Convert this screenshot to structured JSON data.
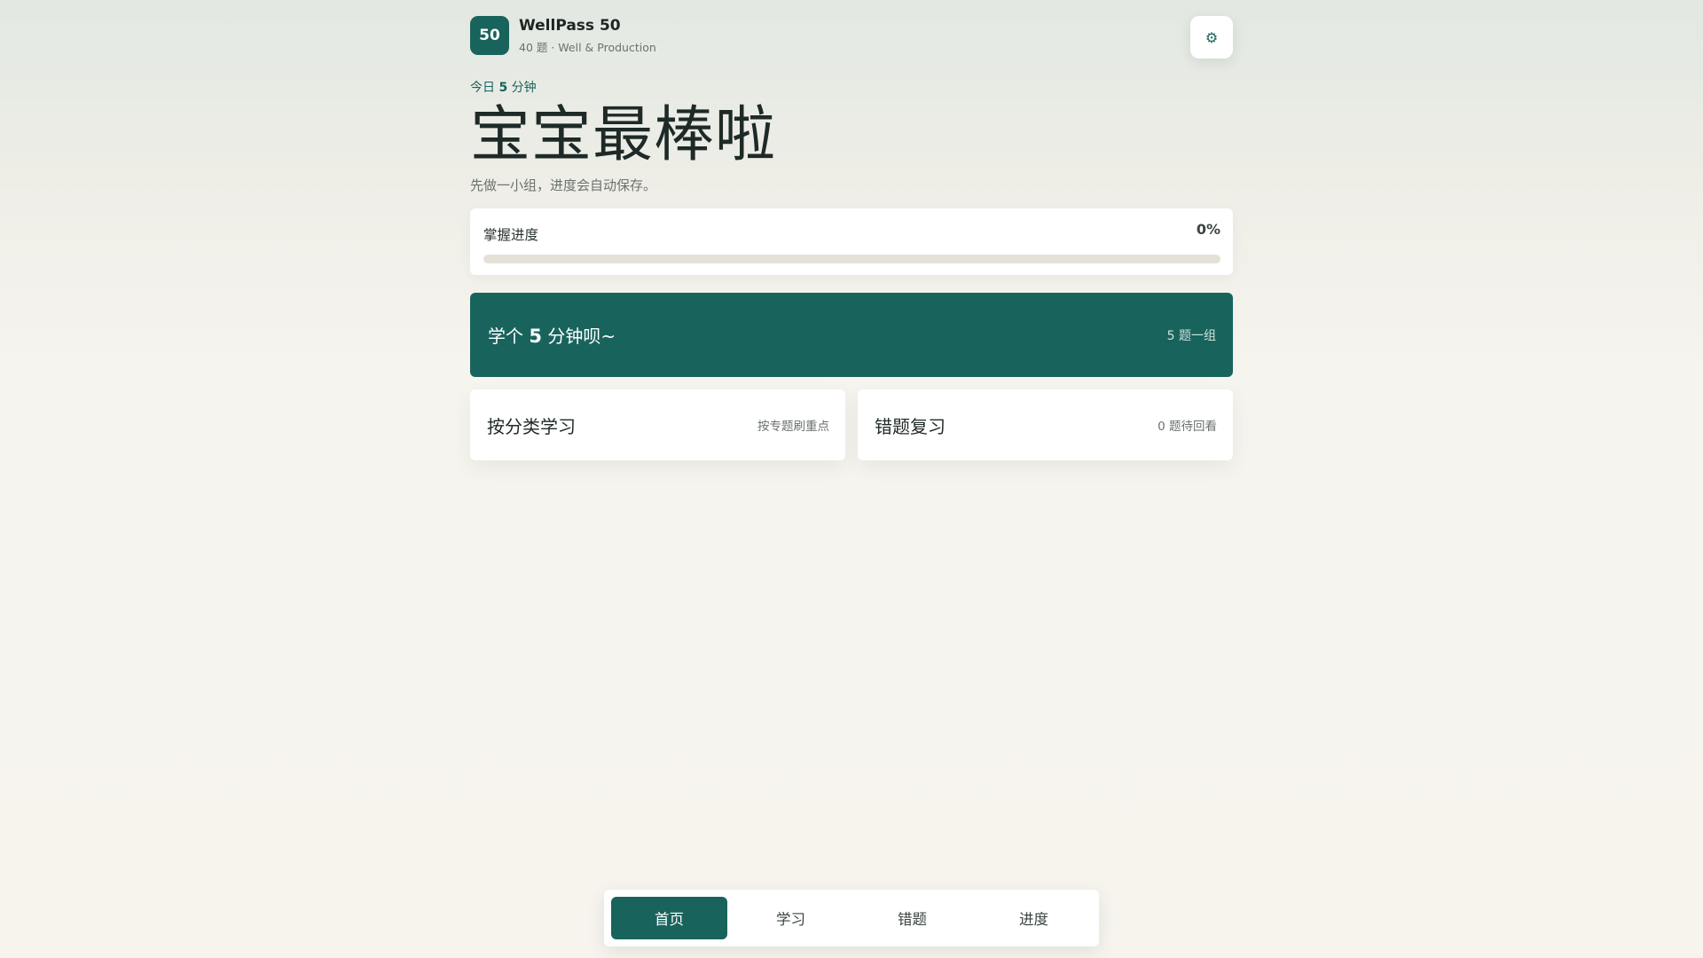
{
  "app": {
    "badge": "50",
    "name": "WellPass 50",
    "subtitle": "40 题 · Well & Production",
    "settings_icon": "gear-icon"
  },
  "hero": {
    "today_prefix": "今日",
    "today_minutes": "5",
    "today_suffix": "分钟",
    "title": "宝宝最棒啦",
    "subtitle": "先做一小组，进度会自动保存。"
  },
  "progress": {
    "label": "掌握进度",
    "value_text": "0%",
    "value": 0
  },
  "cta": {
    "label_prefix": "学个",
    "label_number": "5",
    "label_suffix": "分钟呗~",
    "meta": "5 题一组"
  },
  "cards": [
    {
      "title": "按分类学习",
      "meta": "按专题刷重点"
    },
    {
      "title": "错题复习",
      "meta": "0 题待回看"
    }
  ],
  "nav": {
    "items": [
      {
        "label": "首页",
        "active": true
      },
      {
        "label": "学习",
        "active": false
      },
      {
        "label": "错题",
        "active": false
      },
      {
        "label": "进度",
        "active": false
      }
    ]
  },
  "colors": {
    "accent": "#19635d",
    "track": "#e6e1d8",
    "background": "#f6f4ee"
  }
}
